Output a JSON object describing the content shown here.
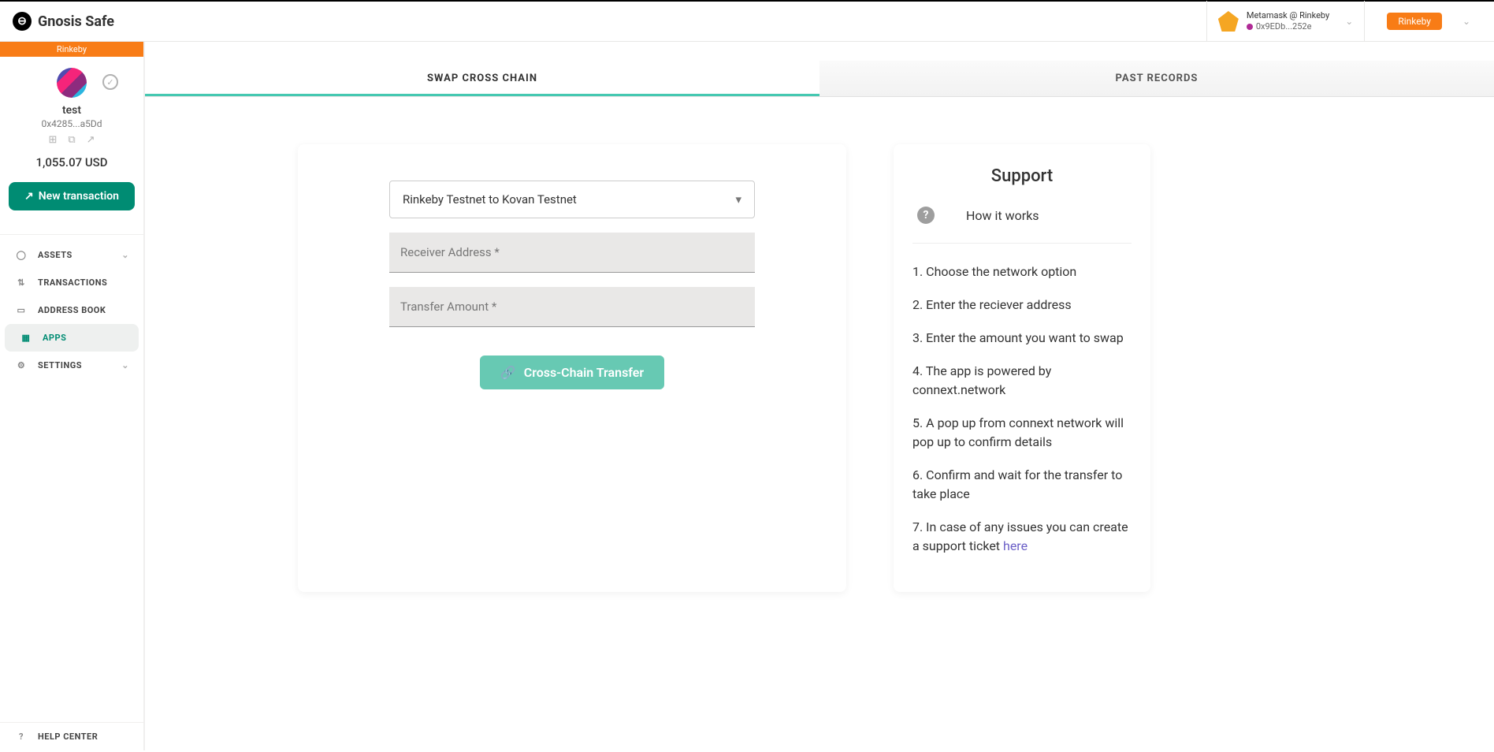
{
  "brand": "Gnosis Safe",
  "topbar": {
    "wallet_name": "Metamask @ Rinkeby",
    "wallet_addr": "0x9EDb...252e",
    "network_pill": "Rinkeby"
  },
  "sidebar": {
    "network": "Rinkeby",
    "safe_name": "test",
    "safe_addr": "0x4285...a5Dd",
    "balance": "1,055.07 USD",
    "new_tx": "New transaction",
    "nav": {
      "assets": "ASSETS",
      "transactions": "TRANSACTIONS",
      "address_book": "ADDRESS BOOK",
      "apps": "APPS",
      "settings": "SETTINGS"
    },
    "help": "HELP CENTER"
  },
  "tabs": {
    "swap": "SWAP CROSS CHAIN",
    "past": "PAST RECORDS"
  },
  "form": {
    "network_select": "Rinkeby Testnet to Kovan Testnet",
    "receiver_placeholder": "Receiver Address *",
    "amount_placeholder": "Transfer Amount *",
    "submit": "Cross-Chain Transfer"
  },
  "support": {
    "title": "Support",
    "how": "How it works",
    "steps": [
      "1. Choose the network option",
      "2. Enter the reciever address",
      "3. Enter the amount you want to swap",
      "4. The app is powered by connext.network",
      "5. A pop up from connext network will pop up to confirm details",
      "6. Confirm and wait for the transfer to take place"
    ],
    "step7_prefix": "7. In case of any issues you can create a support ticket ",
    "step7_link": "here"
  }
}
